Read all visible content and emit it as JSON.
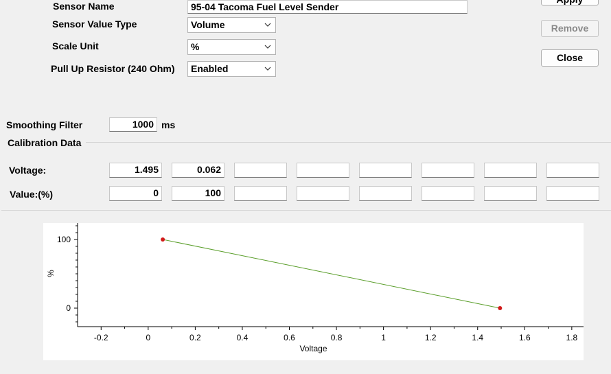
{
  "settings": {
    "sensor_name_label": "Sensor Name",
    "sensor_name_value": "95-04 Tacoma Fuel Level Sender",
    "value_type_label": "Sensor Value Type",
    "value_type_value": "Volume",
    "scale_unit_label": "Scale Unit",
    "scale_unit_value": "%",
    "pullup_label": "Pull Up Resistor (240 Ohm)",
    "pullup_value": "Enabled"
  },
  "buttons": {
    "apply": "Apply",
    "remove": "Remove",
    "close": "Close"
  },
  "smoothing": {
    "label": "Smoothing Filter",
    "value": "1000",
    "unit": "ms"
  },
  "calibration": {
    "group_title": "Calibration Data",
    "voltage_label": "Voltage:",
    "value_label": "Value:(%)",
    "voltage": [
      "1.495",
      "0.062",
      "",
      "",
      "",
      "",
      "",
      ""
    ],
    "values": [
      "0",
      "100",
      "",
      "",
      "",
      "",
      "",
      ""
    ]
  },
  "chart_data": {
    "type": "line",
    "xlabel": "Voltage",
    "ylabel": "%",
    "xlim": [
      -0.3,
      1.85
    ],
    "ylim": [
      -27,
      124
    ],
    "xticks": [
      "-0.2",
      "0",
      "0.2",
      "0.4",
      "0.6",
      "0.8",
      "1",
      "1.2",
      "1.4",
      "1.6",
      "1.8"
    ],
    "yticks": [
      "0",
      "100"
    ],
    "series": [
      {
        "points": [
          [
            0.062,
            100
          ],
          [
            1.495,
            0
          ]
        ],
        "line_color": "#5a9e2a",
        "marker_color": "#d11a1a"
      }
    ]
  }
}
